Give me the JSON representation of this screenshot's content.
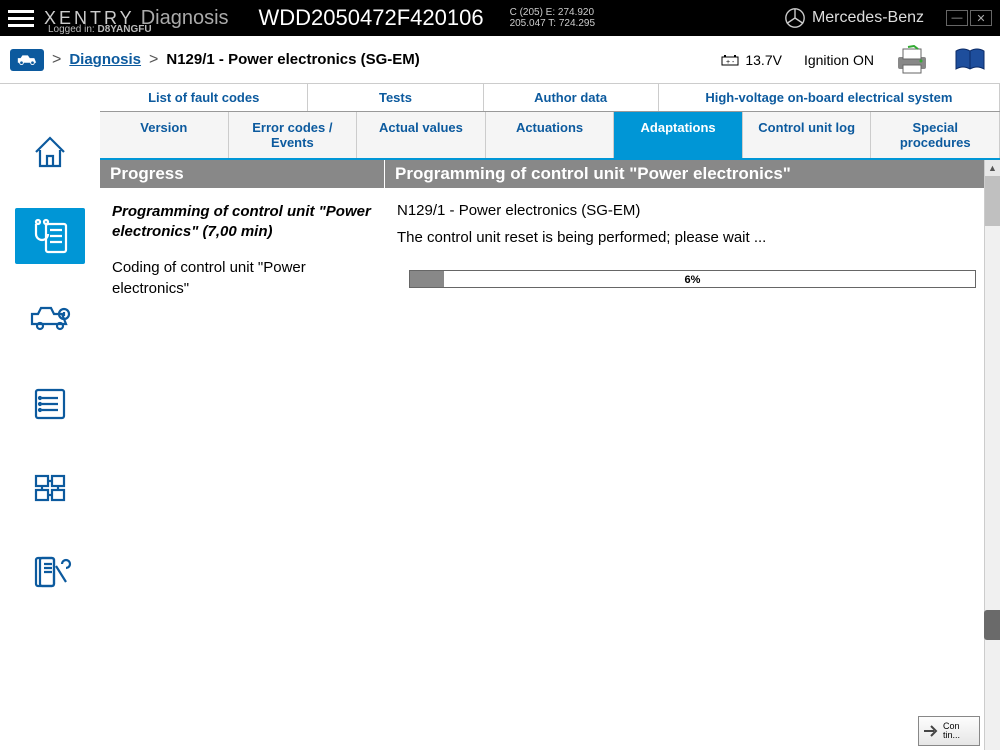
{
  "topbar": {
    "brand_name": "XENTRY",
    "brand_sub": "Diagnosis",
    "login_prefix": "Logged in:",
    "login_user": "D8YANGFU",
    "vin": "WDD2050472F420106",
    "vehcodes_line1": "C (205)   E: 274.920",
    "vehcodes_line2": "205.047  T: 724.295",
    "oem": "Mercedes-Benz"
  },
  "breadcrumb": {
    "root": "Diagnosis",
    "current": "N129/1 - Power electronics (SG-EM)",
    "voltage": "13.7V",
    "ignition": "Ignition ON"
  },
  "tabs1": [
    "List of fault codes",
    "Tests",
    "Author data",
    "High-voltage on-board electrical system"
  ],
  "tabs2": {
    "items": [
      "Version",
      "Error codes / Events",
      "Actual values",
      "Actuations",
      "Adaptations",
      "Control unit log",
      "Special procedures"
    ],
    "active_index": 4
  },
  "left_panel": {
    "title": "Progress",
    "step1": "Programming of control unit \"Power electronics\" (7,00 min)",
    "step2": "Coding of control unit \"Power electronics\""
  },
  "right_panel": {
    "title": "Programming of control unit \"Power electronics\"",
    "ecu": "N129/1 - Power electronics (SG-EM)",
    "status": "The control unit reset is being performed; please wait ...",
    "percent_text": "6%",
    "percent_value": 6
  },
  "continue": {
    "label": "Con\ntin..."
  }
}
